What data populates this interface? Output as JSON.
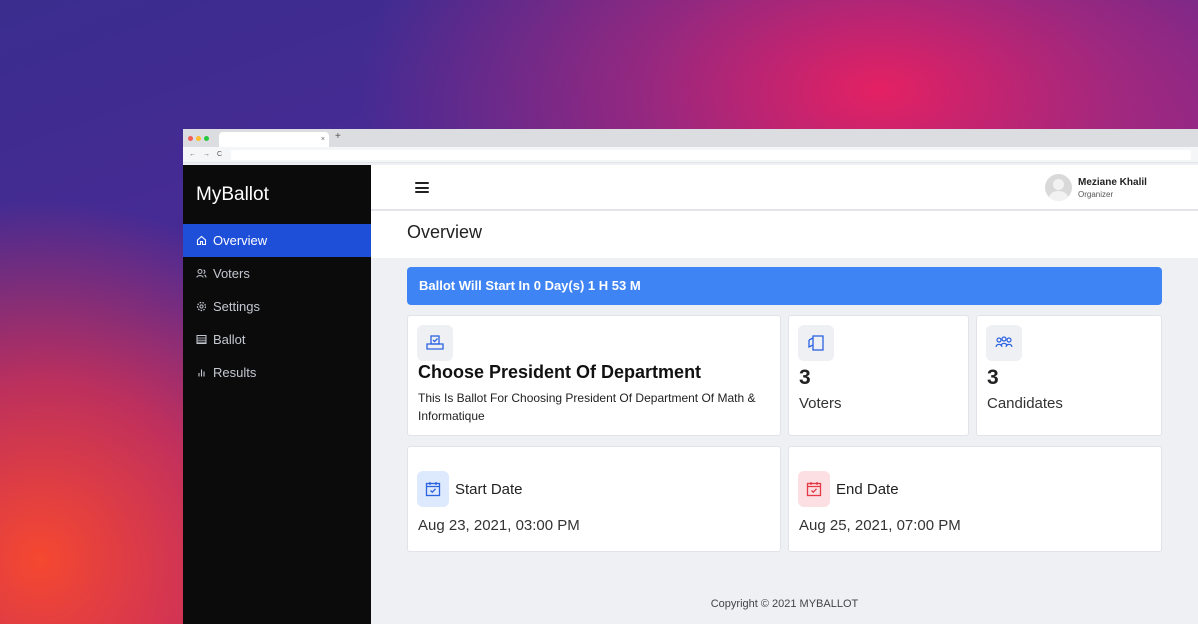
{
  "browser": {
    "tab_close": "×",
    "new_tab": "+",
    "nav": [
      "←",
      "→",
      "C"
    ]
  },
  "app": {
    "brand": "MyBallot"
  },
  "sidebar": {
    "items": [
      {
        "label": "Overview",
        "icon": "home-icon",
        "active": true
      },
      {
        "label": "Voters",
        "icon": "users-icon",
        "active": false
      },
      {
        "label": "Settings",
        "icon": "gear-icon",
        "active": false
      },
      {
        "label": "Ballot",
        "icon": "ballot-icon",
        "active": false
      },
      {
        "label": "Results",
        "icon": "bar-chart-icon",
        "active": false
      }
    ]
  },
  "user": {
    "name": "Meziane Khalil",
    "role": "Organizer"
  },
  "page": {
    "title": "Overview"
  },
  "alert": {
    "text": "Ballot Will Start In 0 Day(s) 1 H 53 M",
    "color": "#3f84f5"
  },
  "ballot": {
    "title": "Choose President Of Department",
    "description": "This Is Ballot For Choosing President Of Department Of Math & Informatique"
  },
  "stats": {
    "voters": {
      "value": "3",
      "label": "Voters"
    },
    "candidates": {
      "value": "3",
      "label": "Candidates"
    }
  },
  "dates": {
    "start": {
      "label": "Start Date",
      "value": "Aug 23, 2021, 03:00 PM"
    },
    "end": {
      "label": "End Date",
      "value": "Aug 25, 2021, 07:00 PM"
    }
  },
  "footer": {
    "text": "Copyright © 2021 MYBALLOT"
  },
  "colors": {
    "accent": "#1e4fd8",
    "sidebar_bg": "#0b0b0c",
    "end_date_icon": "#e53946"
  }
}
